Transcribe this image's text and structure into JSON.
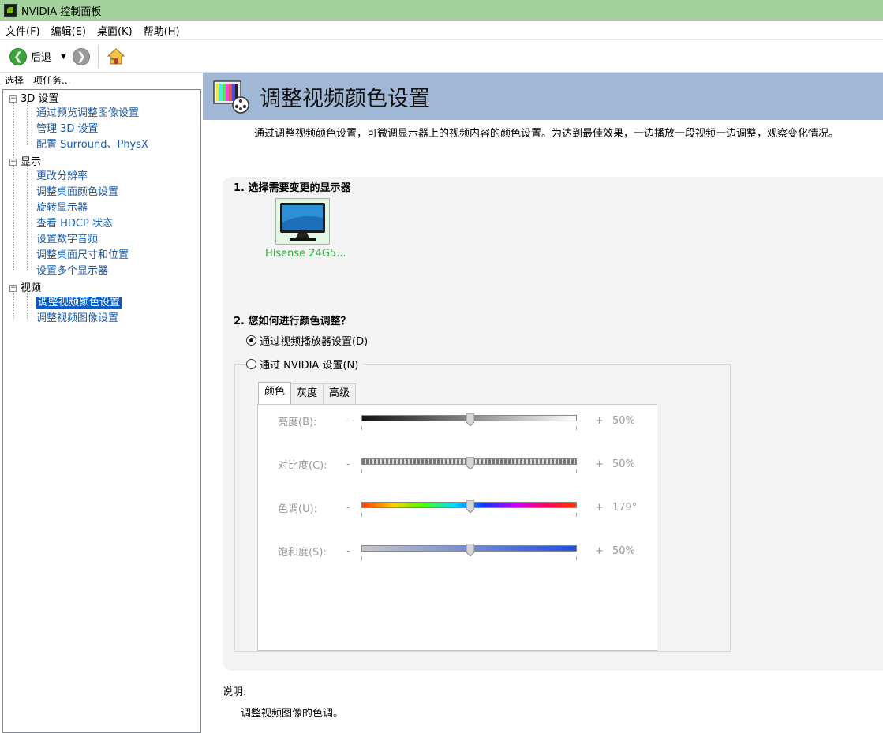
{
  "window": {
    "title": "NVIDIA 控制面板"
  },
  "menu": [
    "文件(F)",
    "编辑(E)",
    "桌面(K)",
    "帮助(H)"
  ],
  "toolbar": {
    "back_label": "后退"
  },
  "left_panel": {
    "heading": "选择一项任务...",
    "tree": [
      {
        "label": "3D 设置",
        "children": [
          "通过预览调整图像设置",
          "管理 3D 设置",
          "配置 Surround、PhysX"
        ]
      },
      {
        "label": "显示",
        "children": [
          "更改分辨率",
          "调整桌面颜色设置",
          "旋转显示器",
          "查看 HDCP 状态",
          "设置数字音频",
          "调整桌面尺寸和位置",
          "设置多个显示器"
        ]
      },
      {
        "label": "视频",
        "children": [
          "调整视频颜色设置",
          "调整视频图像设置"
        ]
      }
    ],
    "selected": "调整视频颜色设置"
  },
  "page": {
    "title": "调整视频颜色设置",
    "intro": "通过调整视频颜色设置，可微调显示器上的视频内容的颜色设置。为达到最佳效果，一边播放一段视频一边调整，观察变化情况。",
    "section1_title": "1. 选择需要变更的显示器",
    "monitor_label": "Hisense 24G5...",
    "section2_title": "2. 您如何进行颜色调整？",
    "option_player": "通过视频播放器设置(D)",
    "option_nvidia": "通过 NVIDIA 设置(N)",
    "selected_option": "player",
    "tabs": [
      "颜色",
      "灰度",
      "高级"
    ],
    "active_tab": "颜色",
    "sliders": [
      {
        "label": "亮度(B):",
        "minus": "-",
        "plus": "+",
        "value": "50%",
        "level": 0.5
      },
      {
        "label": "对比度(C):",
        "minus": "-",
        "plus": "+",
        "value": "50%",
        "level": 0.5
      },
      {
        "label": "色调(U):",
        "minus": "-",
        "plus": "+",
        "value": "179°",
        "level": 0.5
      },
      {
        "label": "饱和度(S):",
        "minus": "-",
        "plus": "+",
        "value": "50%",
        "level": 0.5
      }
    ],
    "desc_label": "说明:",
    "desc_text": "调整视频图像的色调。"
  },
  "colors": {
    "titlebar": "#a4d29c",
    "banner": "#a0b8d6",
    "selection": "#0a5cc4",
    "link": "#1a5aa8",
    "monitor_label": "#2fae3f"
  }
}
